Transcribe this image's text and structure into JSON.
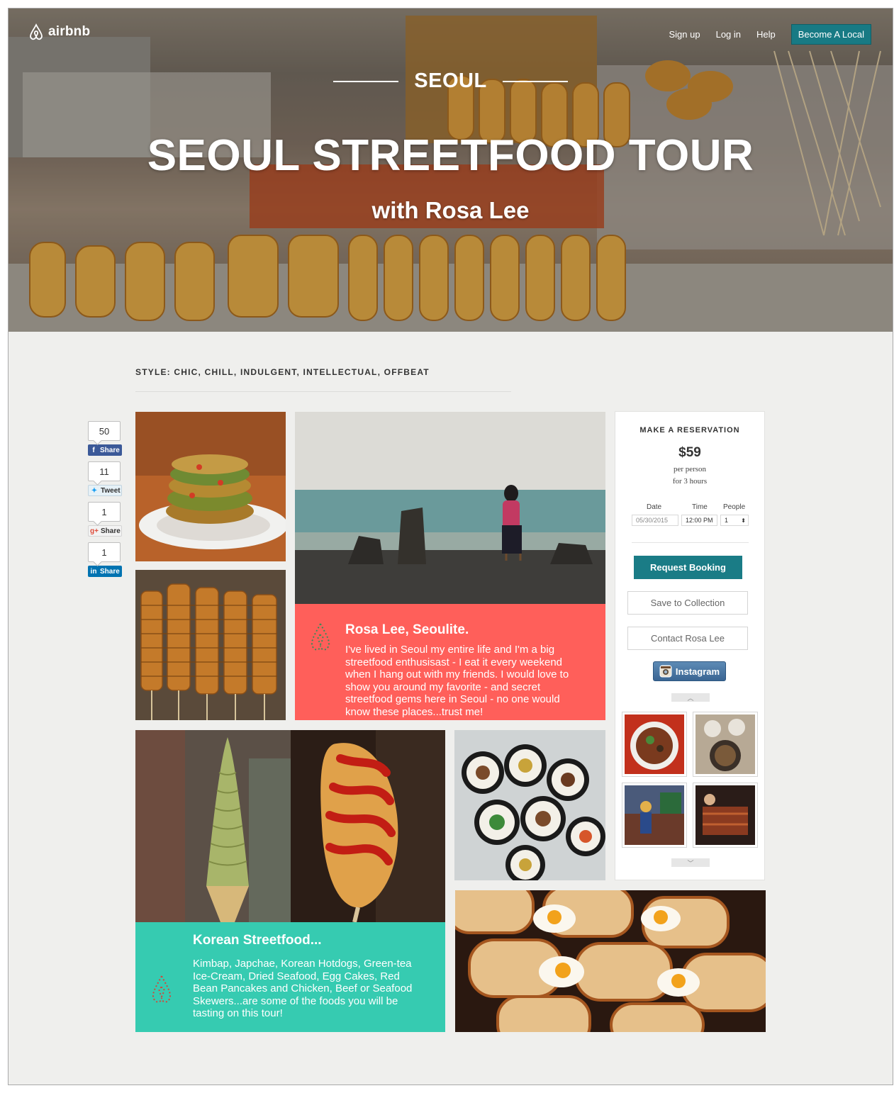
{
  "nav": {
    "logo_text": "airbnb",
    "signup": "Sign up",
    "login": "Log in",
    "help": "Help",
    "become_local": "Become A Local"
  },
  "hero": {
    "city": "SEOUL",
    "title": "SEOUL STREETFOOD TOUR",
    "subtitle": "with Rosa Lee"
  },
  "style_line": "STYLE: CHIC, CHILL, INDULGENT, INTELLECTUAL, OFFBEAT",
  "social": {
    "facebook": {
      "count": "50",
      "label": "Share"
    },
    "twitter": {
      "count": "11",
      "label": "Tweet"
    },
    "google": {
      "count": "1",
      "label": "Share"
    },
    "linkedin": {
      "count": "1",
      "label": "Share"
    }
  },
  "host_card": {
    "title": "Rosa  Lee, Seoulite.",
    "body": "I've lived in Seoul my entire life and I'm a big streetfood enthusisast - I eat it every weekend when I hang out with my friends. I would love to show you around my favorite - and secret streetfood gems here in Seoul - no one would know these places...trust me!"
  },
  "food_card": {
    "title": "Korean Streetfood...",
    "body": "Kimbap, Japchae, Korean Hotdogs, Green-tea Ice-Cream, Dried Seafood, Egg Cakes, Red Bean Pancakes and Chicken, Beef or Seafood Skewers...are some of the foods you will be tasting on this tour!"
  },
  "reservation": {
    "heading": "MAKE A RESERVATION",
    "price": "$59",
    "per": "per person",
    "duration": "for 3 hours",
    "date_label": "Date",
    "date_value": "05/30/2015",
    "time_label": "Time",
    "time_value": "12:00 PM",
    "people_label": "People",
    "people_value": "1",
    "request": "Request Booking",
    "save": "Save to Collection",
    "contact": "Contact Rosa Lee",
    "instagram": "Instagram"
  }
}
